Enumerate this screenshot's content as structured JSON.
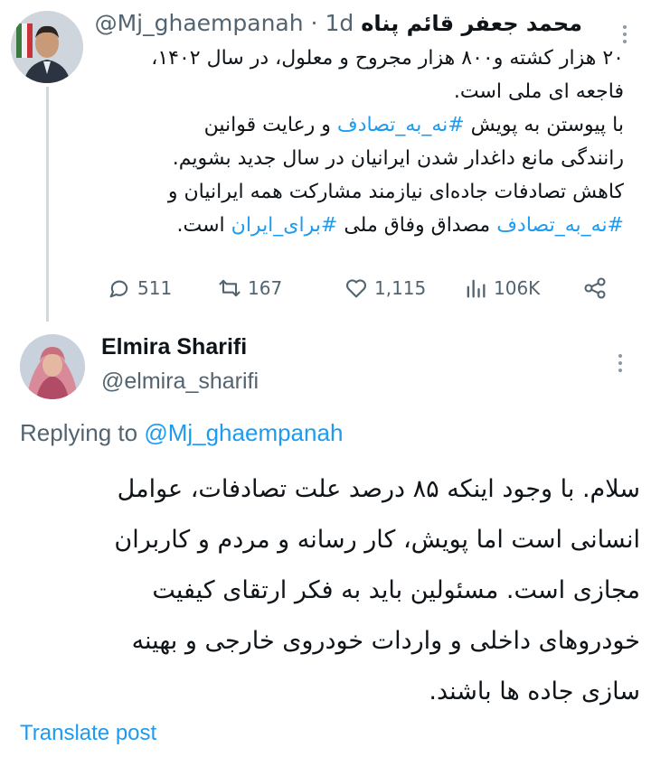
{
  "parent": {
    "author_name": "محمد جعفر قائم پناه",
    "handle": "@Mj_ghaempanah",
    "separator": " · ",
    "age": "1d",
    "text_lines": [
      [
        {
          "t": "۲۰ هزار کشته و۸۰۰ هزار مجروح و معلول، در سال ۱۴۰۲،"
        }
      ],
      [
        {
          "t": "فاجعه ای ملی است."
        }
      ],
      [
        {
          "t": "با پیوستن به پویش "
        },
        {
          "t": "#نه_به_تصادف",
          "tag": true
        },
        {
          "t": " و رعایت قوانین"
        }
      ],
      [
        {
          "t": "رانندگی مانع داغدار شدن ایرانیان در سال جدید بشویم."
        }
      ],
      [
        {
          "t": "کاهش تصادفات جاده‌ای نیازمند مشارکت همه ایرانیان و"
        }
      ],
      [
        {
          "t": "#نه_به_تصادف",
          "tag": true
        },
        {
          "t": "  مصداق وفاق ملی "
        },
        {
          "t": "#برای_ایران",
          "tag": true
        },
        {
          "t": " است."
        }
      ]
    ],
    "actions": {
      "replies": "511",
      "reposts": "167",
      "likes": "1,115",
      "views": "106K"
    },
    "colors": {
      "handle": "#536471",
      "hashtag": "#1d9bf0",
      "thread_line": "#cfd9de"
    }
  },
  "reply": {
    "author_name": "Elmira Sharifi",
    "handle": "@elmira_sharifi",
    "replying_prefix": "Replying to ",
    "replying_to": "@Mj_ghaempanah",
    "text_lines": [
      "سلام. با وجود اینکه ۸۵ درصد علت تصادفات، عوامل",
      "انسانی است اما پویش، کار رسانه و مردم و کاربران",
      "مجازی است. مسئولین باید به فکر ارتقای کیفیت",
      "خودروهای داخلی و واردات خودروی خارجی و بهینه",
      "سازی جاده ها باشند."
    ],
    "translate_label": "Translate post",
    "colors": {
      "link": "#1d9bf0",
      "text": "#0f1419"
    }
  },
  "icons": {
    "reply": "speech-bubble-icon",
    "repost": "repost-arrows-icon",
    "like": "heart-icon",
    "views": "bar-chart-icon",
    "share": "share-icon",
    "more": "more-vertical-icon"
  }
}
